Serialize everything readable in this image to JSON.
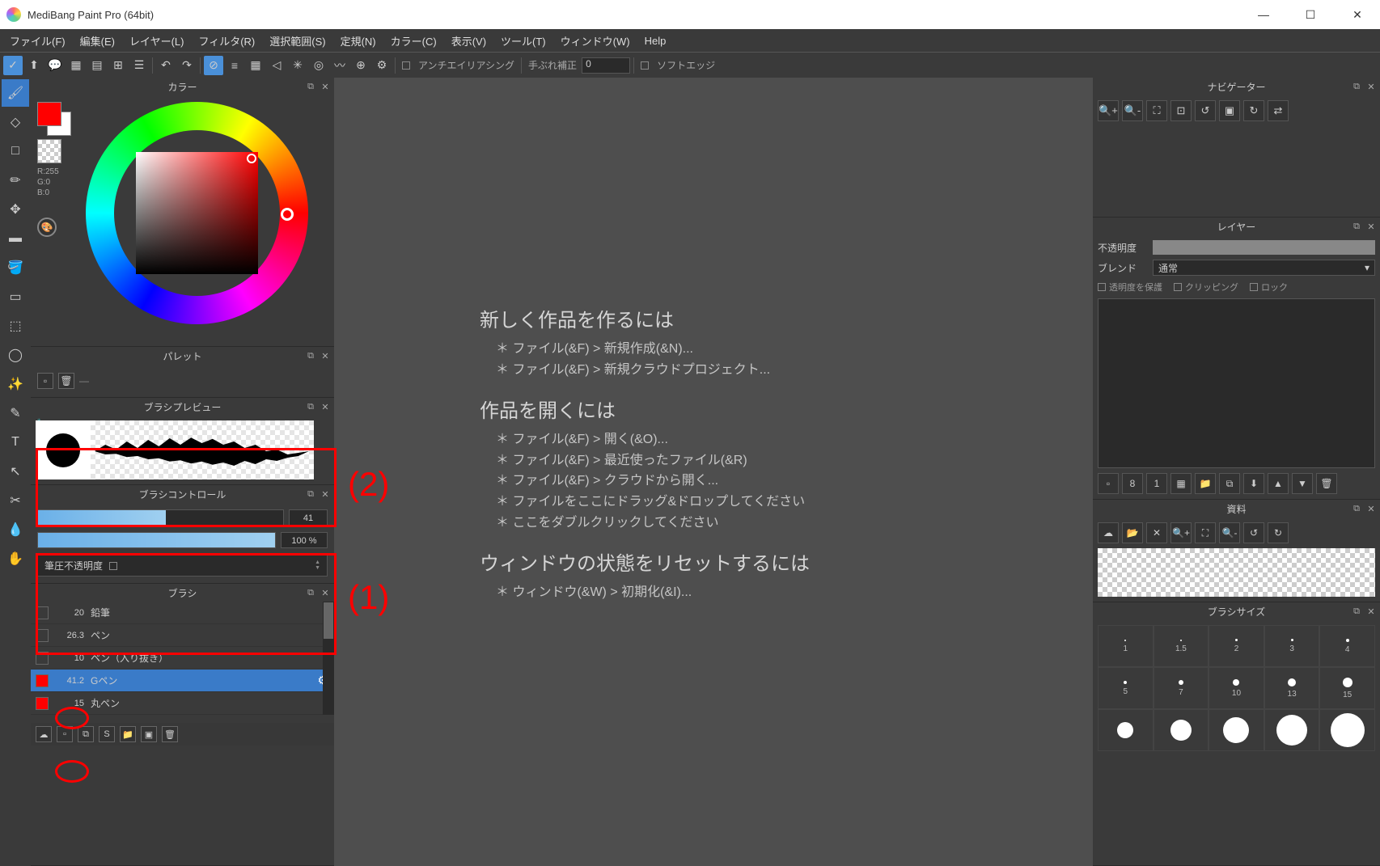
{
  "titlebar": {
    "title": "MediBang Paint Pro (64bit)"
  },
  "menu": [
    "ファイル(F)",
    "編集(E)",
    "レイヤー(L)",
    "フィルタ(R)",
    "選択範囲(S)",
    "定規(N)",
    "カラー(C)",
    "表示(V)",
    "ツール(T)",
    "ウィンドウ(W)",
    "Help"
  ],
  "toolbar": {
    "antialias": "アンチエイリアシング",
    "stabilizer": "手ぶれ補正",
    "stabilizer_val": "0",
    "softedge": "ソフトエッジ"
  },
  "panels": {
    "color": {
      "title": "カラー",
      "rgb": "R:255\nG:0\nB:0"
    },
    "palette": {
      "title": "パレット"
    },
    "brush_preview": {
      "title": "ブラシプレビュー"
    },
    "brush_control": {
      "title": "ブラシコントロール",
      "size": "41",
      "opacity": "100 %",
      "pressure_label": "筆圧不透明度"
    },
    "brush": {
      "title": "ブラシ",
      "items": [
        {
          "num": "20",
          "name": "鉛筆",
          "sel": false,
          "red": false
        },
        {
          "num": "26.3",
          "name": "ペン",
          "sel": false,
          "red": false,
          "circled": true
        },
        {
          "num": "10",
          "name": "ペン（入り抜き）",
          "sel": false,
          "red": false
        },
        {
          "num": "41.2",
          "name": "Gペン",
          "sel": true,
          "red": true,
          "circled": true
        },
        {
          "num": "15",
          "name": "丸ペン",
          "sel": false,
          "red": true
        }
      ]
    },
    "navigator": {
      "title": "ナビゲーター"
    },
    "layer": {
      "title": "レイヤー",
      "opacity": "不透明度",
      "blend": "ブレンド",
      "blend_val": "通常",
      "chk1": "透明度を保護",
      "chk2": "クリッピング",
      "chk3": "ロック"
    },
    "resource": {
      "title": "資料"
    },
    "brush_size": {
      "title": "ブラシサイズ",
      "sizes": [
        1,
        1.5,
        2,
        3,
        4,
        5,
        7,
        10,
        13,
        15
      ]
    }
  },
  "help": {
    "h1": "新しく作品を作るには",
    "l1": "＊ ファイル(&F) > 新規作成(&N)...",
    "l2": "＊ ファイル(&F) > 新規クラウドプロジェクト...",
    "h2": "作品を開くには",
    "l3": "＊ ファイル(&F) > 開く(&O)...",
    "l4": "＊ ファイル(&F) > 最近使ったファイル(&R)",
    "l5": "＊ ファイル(&F) > クラウドから開く...",
    "l6": "＊ ファイルをここにドラッグ&ドロップしてください",
    "l7": "＊ ここをダブルクリックしてください",
    "h3": "ウィンドウの状態をリセットするには",
    "l8": "＊ ウィンドウ(&W) > 初期化(&I)..."
  },
  "annotations": {
    "a1": "(1)",
    "a2": "(2)"
  }
}
